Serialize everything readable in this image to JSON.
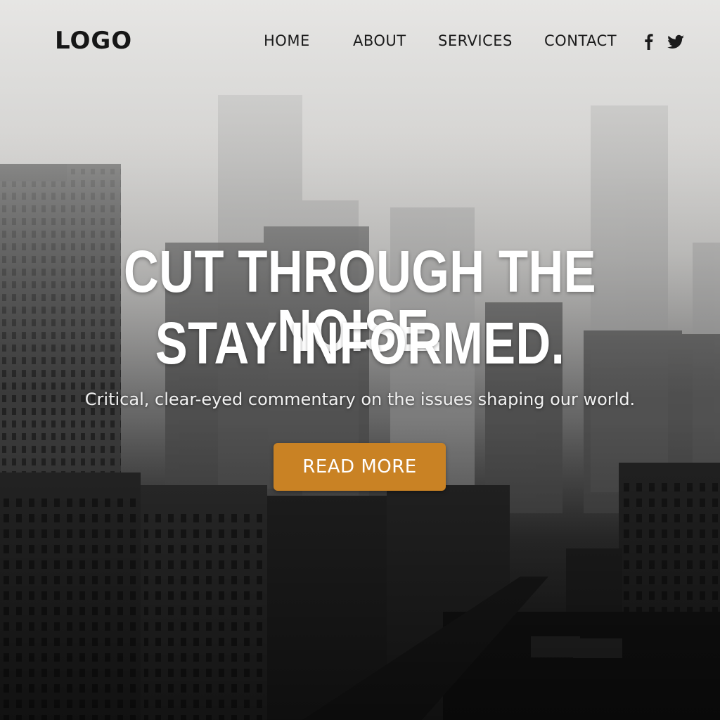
{
  "brand": {
    "logo_text": "LOGO"
  },
  "nav": {
    "items": [
      {
        "label": "HOME"
      },
      {
        "label": "ABOUT"
      },
      {
        "label": "SERVICES"
      },
      {
        "label": "CONTACT"
      }
    ],
    "social": [
      {
        "icon": "facebook-icon"
      },
      {
        "icon": "twitter-icon"
      }
    ]
  },
  "hero": {
    "headline_line1": "CUT THROUGH THE NOISE.",
    "headline_line2": "STAY INFORMED.",
    "subtitle": "Critical, clear-eyed commentary on the issues shaping our world.",
    "cta_label": "READ MORE",
    "background": "foggy city skyline, monochrome"
  },
  "colors": {
    "accent": "#c98224",
    "text_dark": "#1b1b1b",
    "text_light": "#ffffff"
  }
}
